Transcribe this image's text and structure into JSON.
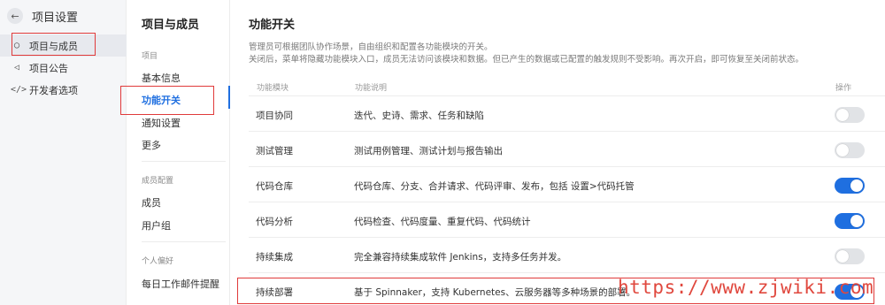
{
  "sidebar": {
    "title": "项目设置",
    "items": [
      {
        "label": "项目与成员",
        "icon": "user-icon"
      },
      {
        "label": "项目公告",
        "icon": "megaphone-icon"
      },
      {
        "label": "开发者选项",
        "icon": "code-icon"
      }
    ]
  },
  "midnav": {
    "title": "项目与成员",
    "groups": [
      {
        "label": "项目",
        "items": [
          "基本信息",
          "功能开关",
          "通知设置",
          "更多"
        ]
      },
      {
        "label": "成员配置",
        "items": [
          "成员",
          "用户组"
        ]
      },
      {
        "label": "个人偏好",
        "items": [
          "每日工作邮件提醒"
        ]
      }
    ],
    "active_item": "功能开关"
  },
  "main": {
    "title": "功能开关",
    "description_line1": "管理员可根据团队协作场景，自由组织和配置各功能模块的开关。",
    "description_line2": "关闭后，菜单将隐藏功能模块入口，成员无法访问该模块和数据。但已产生的数据或已配置的触发规则不受影响。再次开启，即可恢复至关闭前状态。",
    "columns": {
      "module": "功能模块",
      "description": "功能说明",
      "action": "操作"
    },
    "rows": [
      {
        "name": "项目协同",
        "info": "迭代、史诗、需求、任务和缺陷",
        "enabled": false
      },
      {
        "name": "测试管理",
        "info": "测试用例管理、测试计划与报告输出",
        "enabled": false
      },
      {
        "name": "代码仓库",
        "info": "代码仓库、分支、合并请求、代码评审、发布，包括 设置>代码托管",
        "enabled": true
      },
      {
        "name": "代码分析",
        "info": "代码检查、代码度量、重复代码、代码统计",
        "enabled": true
      },
      {
        "name": "持续集成",
        "info": "完全兼容持续集成软件 Jenkins，支持多任务并发。",
        "enabled": false
      },
      {
        "name": "持续部署",
        "info": "基于 Spinnaker，支持 Kubernetes、云服务器等多种场景的部署。",
        "enabled": true
      }
    ]
  },
  "watermark": "https://www.zjwiki.com",
  "colors": {
    "accent": "#1f6fe0",
    "highlight": "#e03a3a",
    "watermark": "#e0483e"
  }
}
